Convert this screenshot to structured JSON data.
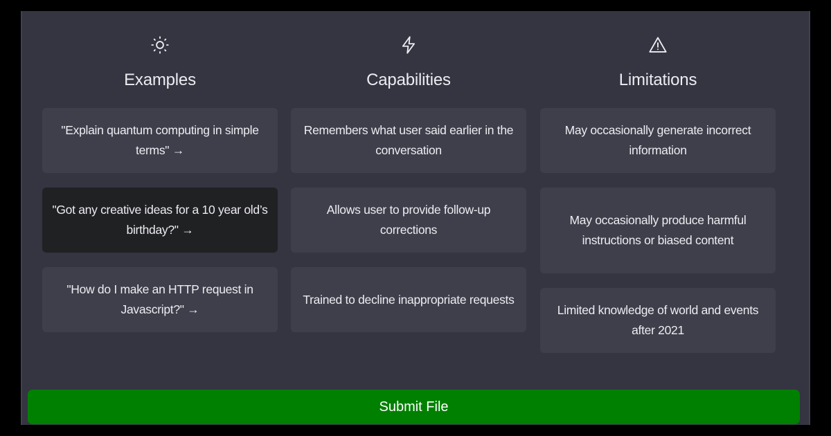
{
  "columns": [
    {
      "title": "Examples",
      "icon": "sun-icon",
      "items": [
        {
          "text": "\"Explain quantum computing in simple terms\" →",
          "selected": false
        },
        {
          "text": "\"Got any creative ideas for a 10 year old’s birthday?\" →",
          "selected": true
        },
        {
          "text": "\"How do I make an HTTP request in Javascript?\" →",
          "selected": false
        }
      ]
    },
    {
      "title": "Capabilities",
      "icon": "lightning-bolt-icon",
      "items": [
        {
          "text": "Remembers what user said earlier in the conversation"
        },
        {
          "text": "Allows user to provide follow-up corrections"
        },
        {
          "text": "Trained to decline inappropriate requests"
        }
      ]
    },
    {
      "title": "Limitations",
      "icon": "warning-triangle-icon",
      "items": [
        {
          "text": "May occasionally generate incorrect information"
        },
        {
          "text": "May occasionally produce harmful instructions or biased content"
        },
        {
          "text": "Limited knowledge of world and events after 2021"
        }
      ]
    }
  ],
  "submit": {
    "label": "Submit File"
  },
  "colors": {
    "background": "#343541",
    "card": "#3e3f4b",
    "card_selected": "#202123",
    "submit": "#008000",
    "text": "#ececf1"
  }
}
